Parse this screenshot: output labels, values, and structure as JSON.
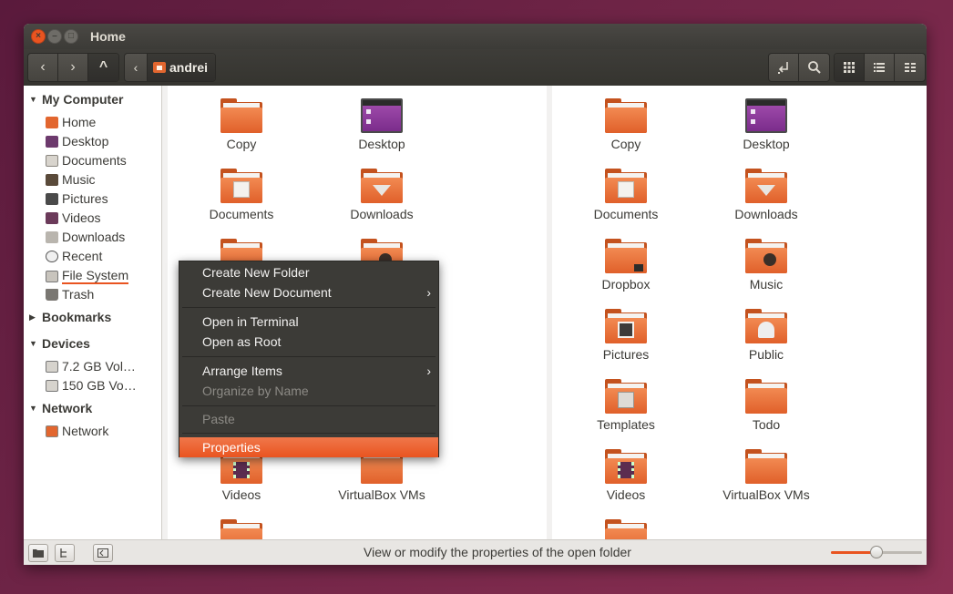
{
  "window": {
    "title": "Home"
  },
  "toolbar": {
    "nav": [
      "‹",
      "›",
      "^"
    ],
    "path_back": "‹",
    "path_current": "andrei",
    "right_icons": [
      "location-icon",
      "search-icon"
    ],
    "view_icons": [
      "grid-view-icon",
      "list-view-icon",
      "compact-view-icon"
    ]
  },
  "sidebar": {
    "my_computer": "My Computer",
    "items": [
      {
        "label": "Home",
        "icon": "home-icon"
      },
      {
        "label": "Desktop",
        "icon": "desktop-icon"
      },
      {
        "label": "Documents",
        "icon": "documents-icon"
      },
      {
        "label": "Music",
        "icon": "music-icon"
      },
      {
        "label": "Pictures",
        "icon": "pictures-icon"
      },
      {
        "label": "Videos",
        "icon": "videos-icon"
      },
      {
        "label": "Downloads",
        "icon": "downloads-icon"
      },
      {
        "label": "Recent",
        "icon": "recent-icon"
      },
      {
        "label": "File System",
        "icon": "file-system-icon"
      },
      {
        "label": "Trash",
        "icon": "trash-icon"
      }
    ],
    "bookmarks": "Bookmarks",
    "devices": "Devices",
    "device_items": [
      {
        "label": "7.2 GB Vol…"
      },
      {
        "label": "150 GB Vo…"
      }
    ],
    "network": "Network",
    "network_items": [
      {
        "label": "Network"
      }
    ]
  },
  "left_pane": {
    "items": [
      {
        "label": "Copy"
      },
      {
        "label": "Desktop"
      },
      {
        "label": "Documents"
      },
      {
        "label": "Downloads"
      },
      {
        "label": "Videos"
      },
      {
        "label": "VirtualBox VMs"
      }
    ]
  },
  "right_pane": {
    "items": [
      {
        "label": "Copy"
      },
      {
        "label": "Desktop"
      },
      {
        "label": "Documents"
      },
      {
        "label": "Downloads"
      },
      {
        "label": "Dropbox"
      },
      {
        "label": "Music"
      },
      {
        "label": "Pictures"
      },
      {
        "label": "Public"
      },
      {
        "label": "Templates"
      },
      {
        "label": "Todo"
      },
      {
        "label": "Videos"
      },
      {
        "label": "VirtualBox VMs"
      }
    ]
  },
  "context_menu": {
    "items": [
      {
        "label": "Create New Folder",
        "enabled": true
      },
      {
        "label": "Create New Document",
        "enabled": true,
        "submenu": true
      },
      {
        "label": "Open in Terminal",
        "enabled": true
      },
      {
        "label": "Open as Root",
        "enabled": true
      },
      {
        "label": "Arrange Items",
        "enabled": true,
        "submenu": true
      },
      {
        "label": "Organize by Name",
        "enabled": false
      },
      {
        "label": "Paste",
        "enabled": false
      },
      {
        "label": "Properties",
        "enabled": true,
        "selected": true
      }
    ],
    "submenu_arrow": "›"
  },
  "statusbar": {
    "text": "View or modify the properties of the open folder",
    "zoom_level": 0.5
  },
  "colors": {
    "accent": "#e95420",
    "window_dark": "#3c3b37",
    "folder_orange": "#e0602a"
  }
}
